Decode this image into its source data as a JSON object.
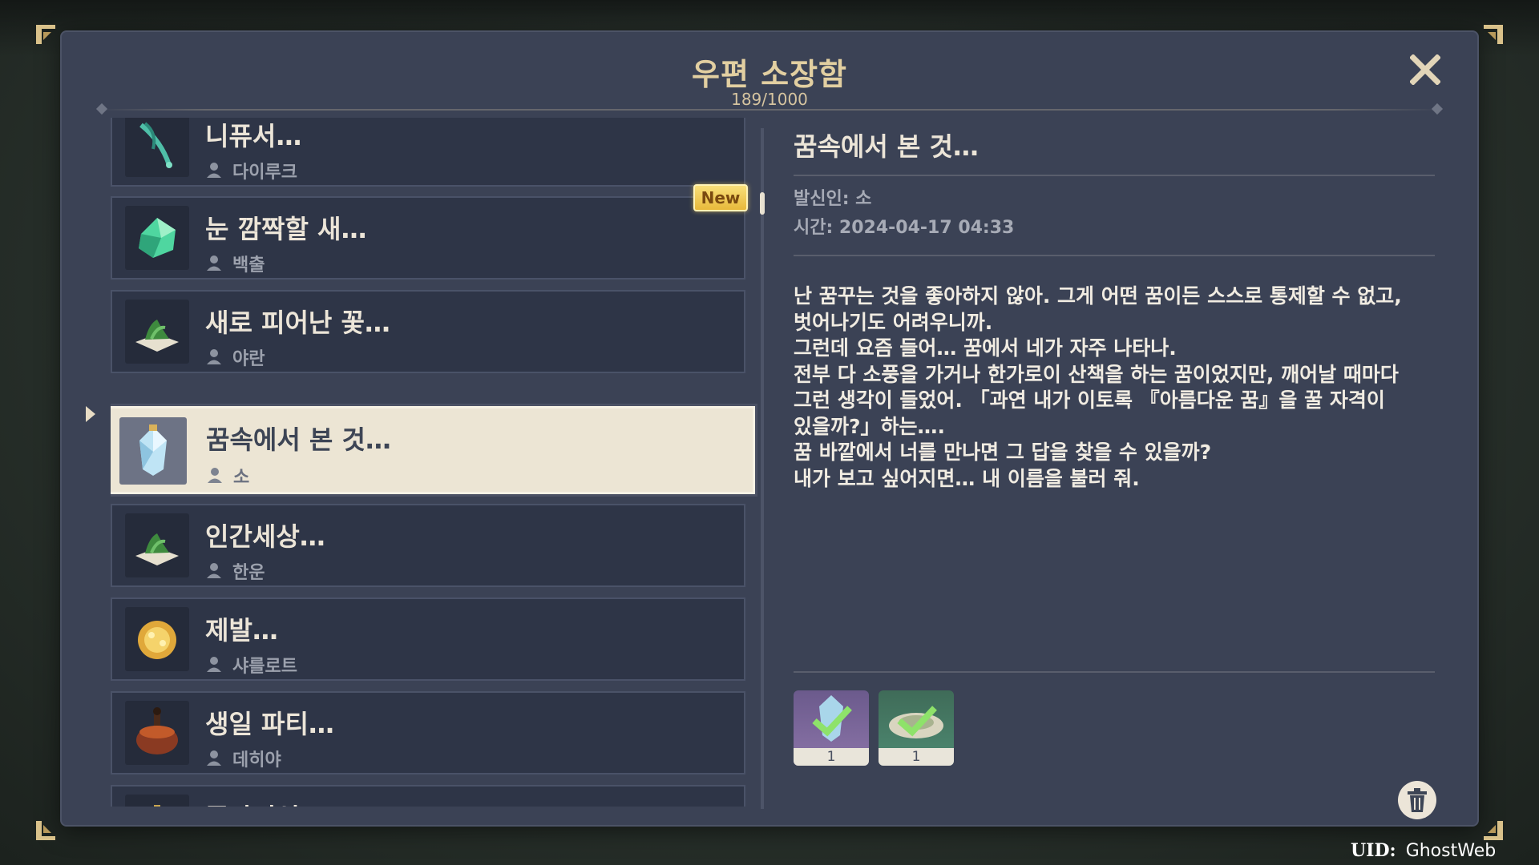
{
  "dialog": {
    "title": "우편 소장함",
    "count": "189/1000"
  },
  "mails": [
    {
      "name": "니퓨서…",
      "sender": "다이루크",
      "icon": "feather-icon"
    },
    {
      "name": "눈 깜짝할 새…",
      "sender": "백출",
      "icon": "crystal-icon",
      "badge": "New"
    },
    {
      "name": "새로 피어난 꽃…",
      "sender": "야란",
      "icon": "herb-dish-icon"
    },
    {
      "name": "꿈속에서 본 것…",
      "sender": "소",
      "icon": "dream-crystal-icon",
      "selected": true
    },
    {
      "name": "인간세상…",
      "sender": "한운",
      "icon": "herb-dish-icon"
    },
    {
      "name": "제발…",
      "sender": "샤를로트",
      "icon": "pastry-icon"
    },
    {
      "name": "생일 파티…",
      "sender": "데히야",
      "icon": "stew-pot-icon"
    },
    {
      "name": "폰타인성…",
      "sender": "",
      "icon": "gear-icon"
    }
  ],
  "detail": {
    "title": "꿈속에서 본 것…",
    "sender": "발신인: 소",
    "time": "시간: 2024-04-17 04:33",
    "body": [
      "난 꿈꾸는 것을 좋아하지 않아. 그게 어떤 꿈이든 스스로 통제할 수 없고,",
      "벗어나기도 어려우니까.",
      "그런데 요즘 들어… 꿈에서 네가 자주 나타나.",
      "전부 다 소풍을 가거나 한가로이 산책을 하는 꿈이었지만, 깨어날 때마다",
      "그런 생각이 들었어. 「과연 내가 이토록 『아름다운 꿈』을 꿀 자격이",
      "있을까?」하는….",
      "꿈 바깥에서 너를 만나면 그 답을 찾을 수 있을까?",
      "내가 보고 싶어지면… 내 이름을 불러 줘."
    ],
    "attachments": [
      {
        "qty": "1",
        "icon": "crystal-claimed-icon",
        "color": "#6b5a8c"
      },
      {
        "qty": "1",
        "icon": "dish-claimed-icon",
        "color": "#3f6b58"
      }
    ]
  },
  "footer": {
    "uid_label": "UID:",
    "uid_value": "GhostWeb"
  },
  "colors": {
    "panel": "#3b4255",
    "item": "#2e3547",
    "selected": "#ece5d4",
    "gold": "#e2cfa1",
    "new_badge": "#f2cc55"
  }
}
